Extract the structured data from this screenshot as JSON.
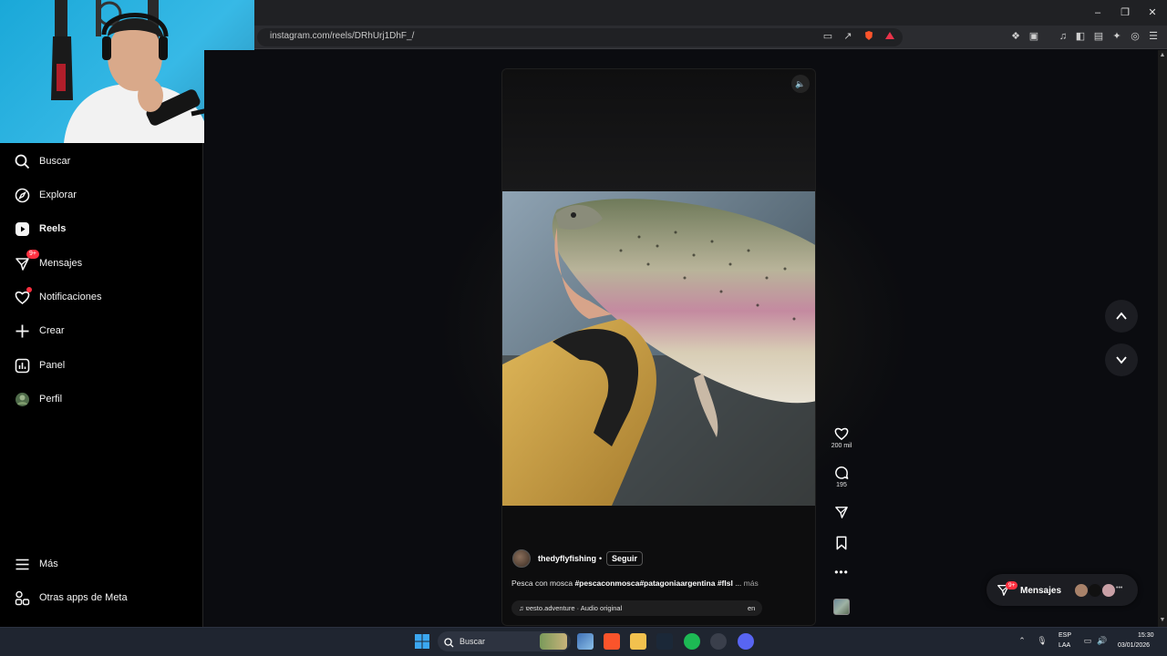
{
  "browser": {
    "url": "instagram.com/reels/DRhUrj1DhF_/"
  },
  "sidebar": {
    "items": [
      {
        "label": "Buscar",
        "icon": "search-icon",
        "active": false
      },
      {
        "label": "Explorar",
        "icon": "compass-icon",
        "active": false
      },
      {
        "label": "Reels",
        "icon": "reels-icon",
        "active": true
      },
      {
        "label": "Mensajes",
        "icon": "messenger-icon",
        "badge": "9+"
      },
      {
        "label": "Notificaciones",
        "icon": "heart-icon",
        "dot": true
      },
      {
        "label": "Crear",
        "icon": "plus-icon"
      },
      {
        "label": "Panel",
        "icon": "dashboard-icon"
      },
      {
        "label": "Perfil",
        "icon": "profile-avatar"
      }
    ],
    "bottom": [
      {
        "label": "Más",
        "icon": "menu-icon"
      },
      {
        "label": "Otras apps de Meta",
        "icon": "apps-icon"
      }
    ]
  },
  "reel": {
    "author": "thedyflyfishing",
    "separator": "•",
    "follow_label": "Seguir",
    "caption_prefix": "Pesca con mosca ",
    "caption_tags": "#pescaconmosca#patagoniaargentina #flsl",
    "caption_ellipsis": " ... ",
    "caption_more": "más",
    "audio": "ɐesto.adventure · Audio original",
    "audio_lang": "en",
    "likes": "200 mil",
    "comments": "195"
  },
  "messages_pill": {
    "label": "Mensajes",
    "badge": "9+"
  },
  "taskbar": {
    "search_label": "Buscar",
    "lang_line1": "ESP",
    "lang_line2": "LAA",
    "time": "15:30",
    "date": "03/01/2026"
  },
  "colors": {
    "accent_red": "#ff3040",
    "background": "#0b0c10",
    "sidebar": "#000000"
  }
}
